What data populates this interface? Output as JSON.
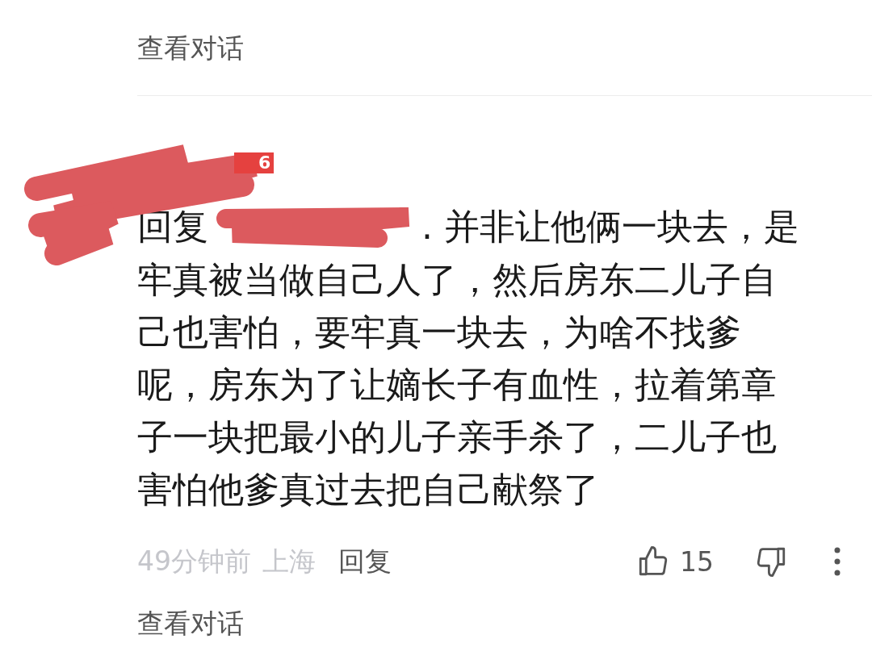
{
  "top_link": "查看对话",
  "comment": {
    "badge": "6",
    "reply_label": "回复",
    "text_lead": ". 并非让他俩一块去，是",
    "text": "牢真被当做自己人了，然后房东二儿子自己也害怕，要牢真一块去，为啥不找爹呢，房东为了让嫡长子有血性，拉着第章子一块把最小的儿子亲手杀了，二儿子也害怕他爹真过去把自己献祭了",
    "time": "49分钟前",
    "location": "上海",
    "reply_button": "回复",
    "likes": "15"
  },
  "bottom_link": "查看对话"
}
